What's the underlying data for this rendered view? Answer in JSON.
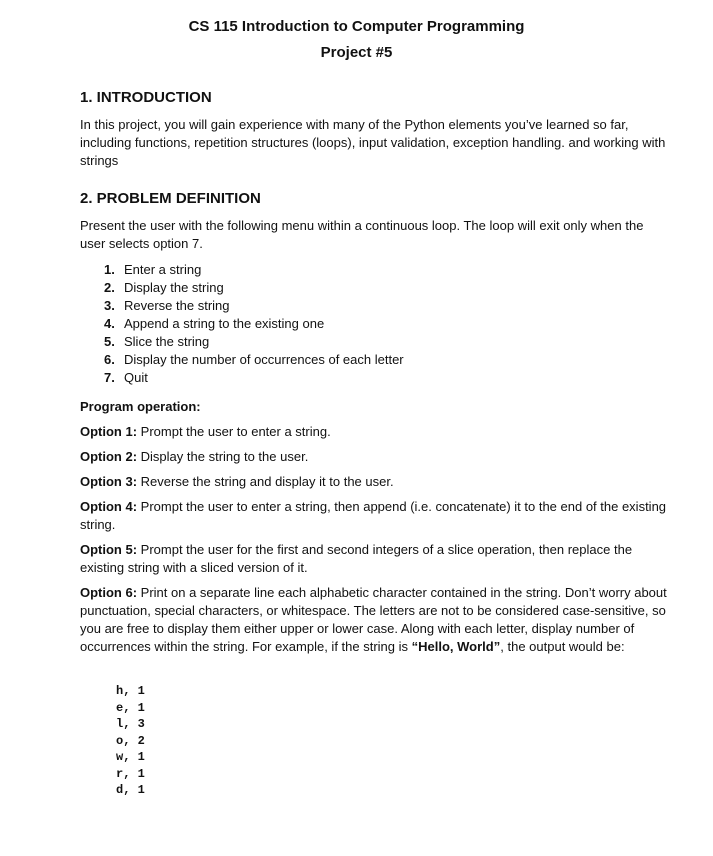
{
  "header": {
    "course_title": "CS 115 Introduction to Computer Programming",
    "project_title": "Project #5"
  },
  "introduction": {
    "heading": "1. INTRODUCTION",
    "body": "In this project, you will gain experience with many of the Python elements you’ve learned so far, including functions, repetition structures (loops), input validation, exception handling. and working with strings"
  },
  "problem_definition": {
    "heading": "2. PROBLEM DEFINITION",
    "body": "Present the user with the following menu within a continuous loop.  The loop will exit only when the user selects option 7.",
    "menu": [
      {
        "num": "1.",
        "label": "Enter a string"
      },
      {
        "num": "2.",
        "label": "Display the string"
      },
      {
        "num": "3.",
        "label": "Reverse the string"
      },
      {
        "num": "4.",
        "label": "Append a string to the existing one"
      },
      {
        "num": "5.",
        "label": "Slice the string"
      },
      {
        "num": "6.",
        "label": "Display the number of occurrences of each letter"
      },
      {
        "num": "7.",
        "label": "Quit"
      }
    ],
    "program_operation_heading": "Program operation:",
    "options": [
      {
        "label": "Option 1:",
        "text": " Prompt the user to enter a string."
      },
      {
        "label": "Option 2:",
        "text": " Display the string to the user."
      },
      {
        "label": "Option 3:",
        "text": " Reverse the string and display it to the user."
      },
      {
        "label": "Option 4:",
        "text": " Prompt the user to enter a string, then append (i.e. concatenate) it to the end of the existing string."
      },
      {
        "label": "Option 5:",
        "text": " Prompt the user for the first and second integers of a slice operation, then replace the existing string with a sliced version of it."
      },
      {
        "label": "Option 6:",
        "text": " Print on a separate line each alphabetic character contained in the string.  Don’t worry about punctuation, special characters, or whitespace.  The letters are not to be considered case-sensitive, so you are free to display them either upper or lower case.  Along with each letter, display number of occurrences within the string.  For example, if the string is ",
        "example": "“Hello, World”",
        "after": ", the output would be:"
      }
    ],
    "example_output": [
      "h, 1",
      "e, 1",
      "l, 3",
      "o, 2",
      "w, 1",
      "r, 1",
      "d, 1"
    ]
  }
}
